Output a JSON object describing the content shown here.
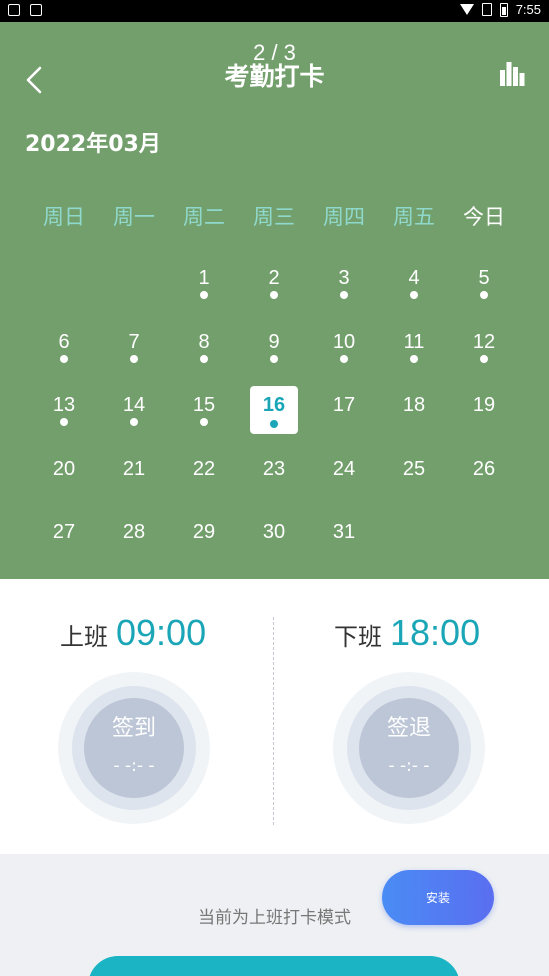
{
  "status_bar": {
    "time": "7:55"
  },
  "header": {
    "page_counter": "2 / 3",
    "title": "考勤打卡"
  },
  "calendar": {
    "month": "2022年03月",
    "weekdays": [
      "周日",
      "周一",
      "周二",
      "周三",
      "周四",
      "周五",
      "今日"
    ],
    "selected_day": "16",
    "weeks": [
      [
        {
          "d": ""
        },
        {
          "d": ""
        },
        {
          "d": "1",
          "dot": true
        },
        {
          "d": "2",
          "dot": true
        },
        {
          "d": "3",
          "dot": true
        },
        {
          "d": "4",
          "dot": true
        },
        {
          "d": "5",
          "dot": true
        }
      ],
      [
        {
          "d": "6",
          "dot": true
        },
        {
          "d": "7",
          "dot": true
        },
        {
          "d": "8",
          "dot": true
        },
        {
          "d": "9",
          "dot": true
        },
        {
          "d": "10",
          "dot": true
        },
        {
          "d": "11",
          "dot": true
        },
        {
          "d": "12",
          "dot": true
        }
      ],
      [
        {
          "d": "13",
          "dot": true
        },
        {
          "d": "14",
          "dot": true
        },
        {
          "d": "15",
          "dot": true
        },
        {
          "d": "16",
          "dot": true,
          "selected": true
        },
        {
          "d": "17"
        },
        {
          "d": "18"
        },
        {
          "d": "19"
        }
      ],
      [
        {
          "d": "20"
        },
        {
          "d": "21"
        },
        {
          "d": "22"
        },
        {
          "d": "23"
        },
        {
          "d": "24"
        },
        {
          "d": "25"
        },
        {
          "d": "26"
        }
      ],
      [
        {
          "d": "27"
        },
        {
          "d": "28"
        },
        {
          "d": "29"
        },
        {
          "d": "30"
        },
        {
          "d": "31"
        },
        {
          "d": ""
        },
        {
          "d": ""
        }
      ]
    ]
  },
  "checkin": {
    "on_label": "上班",
    "on_time": "09:00",
    "off_label": "下班",
    "off_time": "18:00",
    "checkin_button": "签到",
    "checkin_placeholder": "- -:- -",
    "checkout_button": "签退",
    "checkout_placeholder": "- -:- -"
  },
  "footer": {
    "mode_text": "当前为上班打卡模式",
    "install_button": "安装"
  },
  "colors": {
    "header_green": "#739f6d",
    "accent_teal": "#1aa6b7",
    "weekday_teal": "#8fd9cc",
    "install_blue": "#4a8cf5"
  }
}
